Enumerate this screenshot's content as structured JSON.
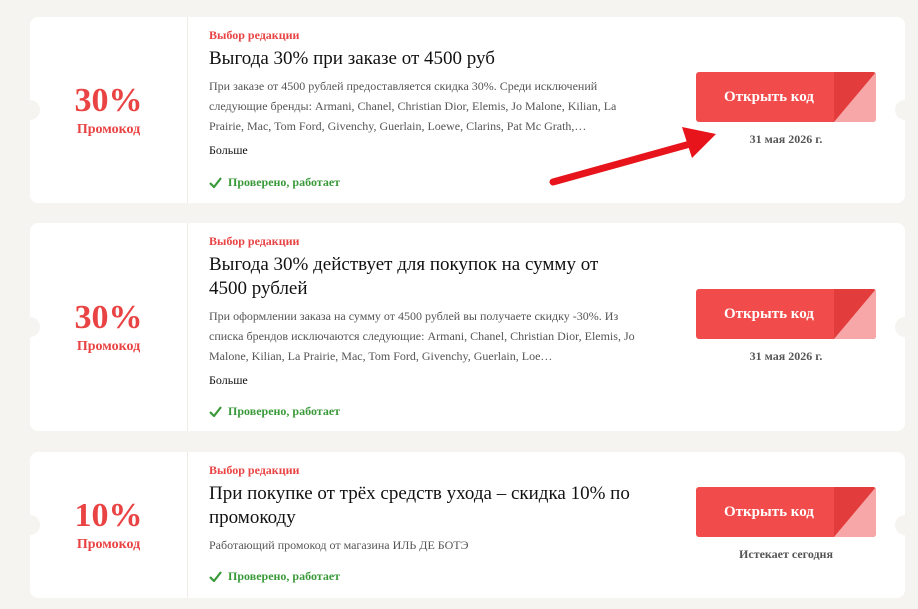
{
  "coupons": [
    {
      "percent": "30%",
      "percent_label": "Промокод",
      "editor_label": "Выбор редакции",
      "title": "Выгода 30% при заказе от 4500 руб",
      "description": "При заказе от 4500 рублей предоставляется скидка 30%. Среди исключений следующие бренды: Armani, Chanel, Christian Dior, Elemis, Jo Malone, Kilian, La Prairie, Mac, Tom Ford, Givenchy, Guerlain, Loewe, Clarins, Pat Mc Grath,…",
      "more_label": "Больше",
      "verified_label": "Проверено, работает",
      "button_label": "Открыть код",
      "date": "31 мая 2026 г."
    },
    {
      "percent": "30%",
      "percent_label": "Промокод",
      "editor_label": "Выбор редакции",
      "title": "Выгода 30% действует для покупок на сумму от 4500 рублей",
      "description": "При оформлении заказа на сумму от 4500 рублей вы получаете скидку -30%. Из списка брендов исключаются следующие: Armani, Chanel, Christian Dior, Elemis, Jo Malone, Kilian, La Prairie, Mac, Tom Ford, Givenchy, Guerlain, Loe…",
      "more_label": "Больше",
      "verified_label": "Проверено, работает",
      "button_label": "Открыть код",
      "date": "31 мая 2026 г."
    },
    {
      "percent": "10%",
      "percent_label": "Промокод",
      "editor_label": "Выбор редакции",
      "title": "При покупке от трёх средств ухода – скидка 10% по промокоду",
      "description": "Работающий промокод от магазина ИЛЬ ДЕ БОТЭ",
      "verified_label": "Проверено, работает",
      "button_label": "Открыть код",
      "date": "Истекает сегодня"
    }
  ],
  "colors": {
    "accent": "#e94343",
    "button": "#f14b4b",
    "verified": "#3a9a3a",
    "arrow": "#e8141c"
  },
  "icons": {
    "verified": "checkmark-icon",
    "annotation": "red-arrow"
  }
}
